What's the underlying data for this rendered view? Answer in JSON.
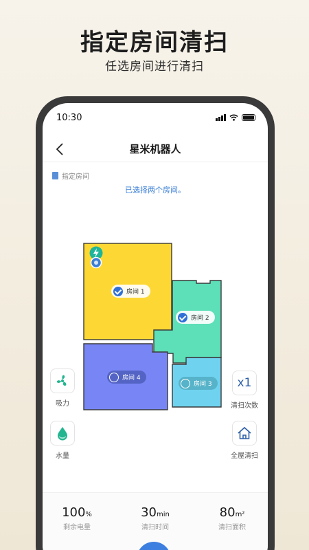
{
  "promo": {
    "title": "指定房间清扫",
    "subtitle": "任选房间进行清扫"
  },
  "status_bar": {
    "time": "10:30",
    "icons": [
      "signal-icon",
      "wifi-icon",
      "battery-icon"
    ]
  },
  "nav": {
    "back_icon": "chevron-left-icon",
    "title": "星米机器人"
  },
  "mode": {
    "label": "指定房间",
    "hint": "已选择两个房间。"
  },
  "map": {
    "rooms": [
      {
        "name": "房间 1",
        "selected": true,
        "color": "#fdd835"
      },
      {
        "name": "房间 2",
        "selected": true,
        "color": "#5ddfb8"
      },
      {
        "name": "房间 3",
        "selected": false,
        "color": "#6fd3f0"
      },
      {
        "name": "房间 4",
        "selected": false,
        "color": "#7886f5"
      }
    ],
    "dock_icon": "charging-dock-icon",
    "robot_icon": "robot-vacuum-icon"
  },
  "controls": {
    "suction": {
      "label": "吸力",
      "icon": "fan-icon"
    },
    "water": {
      "label": "水量",
      "icon": "water-drop-icon"
    },
    "clean_count": {
      "label": "清扫次数",
      "value": "x1"
    },
    "whole_house": {
      "label": "全屋清扫",
      "icon": "home-icon"
    }
  },
  "stats": [
    {
      "value": "100",
      "unit": "%",
      "label": "剩余电量"
    },
    {
      "value": "30",
      "unit": "min",
      "label": "清扫时间"
    },
    {
      "value": "80",
      "unit": "m²",
      "label": "清扫面积"
    }
  ],
  "colors": {
    "accent": "#3d7fe0",
    "hint_text": "#3b7fd6",
    "phone_frame": "#3a3a3a"
  }
}
